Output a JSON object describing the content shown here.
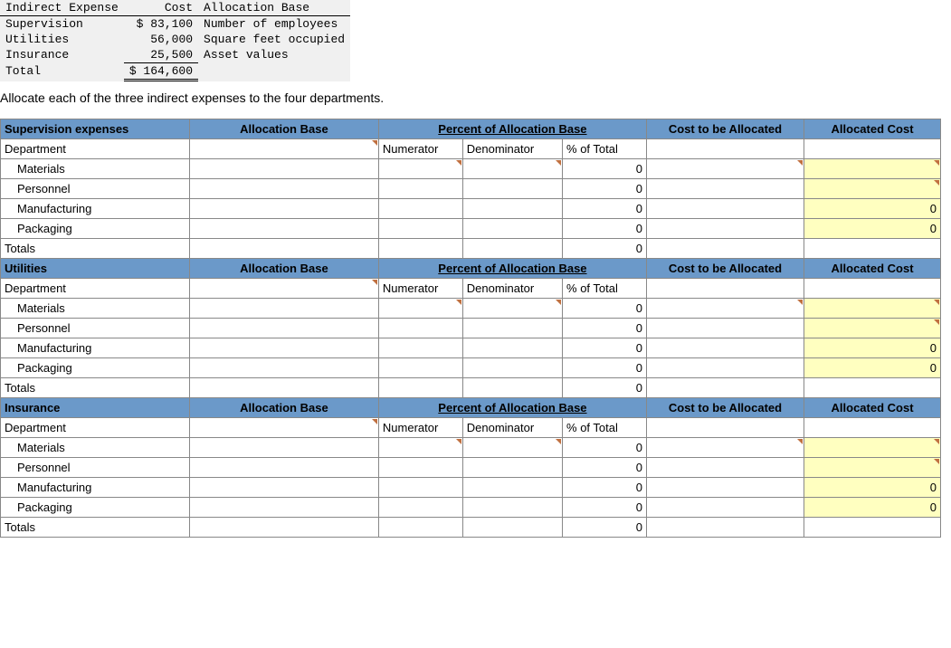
{
  "topTable": {
    "headers": [
      "Indirect Expense",
      "Cost",
      "Allocation Base"
    ],
    "rows": [
      {
        "name": "Supervision",
        "cost": "$ 83,100",
        "base": "Number of employees"
      },
      {
        "name": "Utilities",
        "cost": "56,000",
        "base": "Square feet occupied"
      },
      {
        "name": "Insurance",
        "cost": "25,500",
        "base": "Asset values"
      }
    ],
    "totalLabel": "Total",
    "totalCost": "$ 164,600"
  },
  "instruction": "Allocate each of the three indirect expenses to the four departments.",
  "headers": {
    "allocBase": "Allocation Base",
    "percentAlloc": "Percent of Allocation Base",
    "costToAlloc": "Cost to be Allocated",
    "allocCost": "Allocated Cost",
    "department": "Department",
    "numerator": "Numerator",
    "denominator": "Denominator",
    "pctTotal": "% of Total",
    "totals": "Totals"
  },
  "sections": [
    {
      "title": "Supervision expenses"
    },
    {
      "title": "Utilities"
    },
    {
      "title": "Insurance"
    }
  ],
  "deptRows": [
    "Materials",
    "Personnel",
    "Manufacturing",
    "Packaging"
  ],
  "zero": "0"
}
